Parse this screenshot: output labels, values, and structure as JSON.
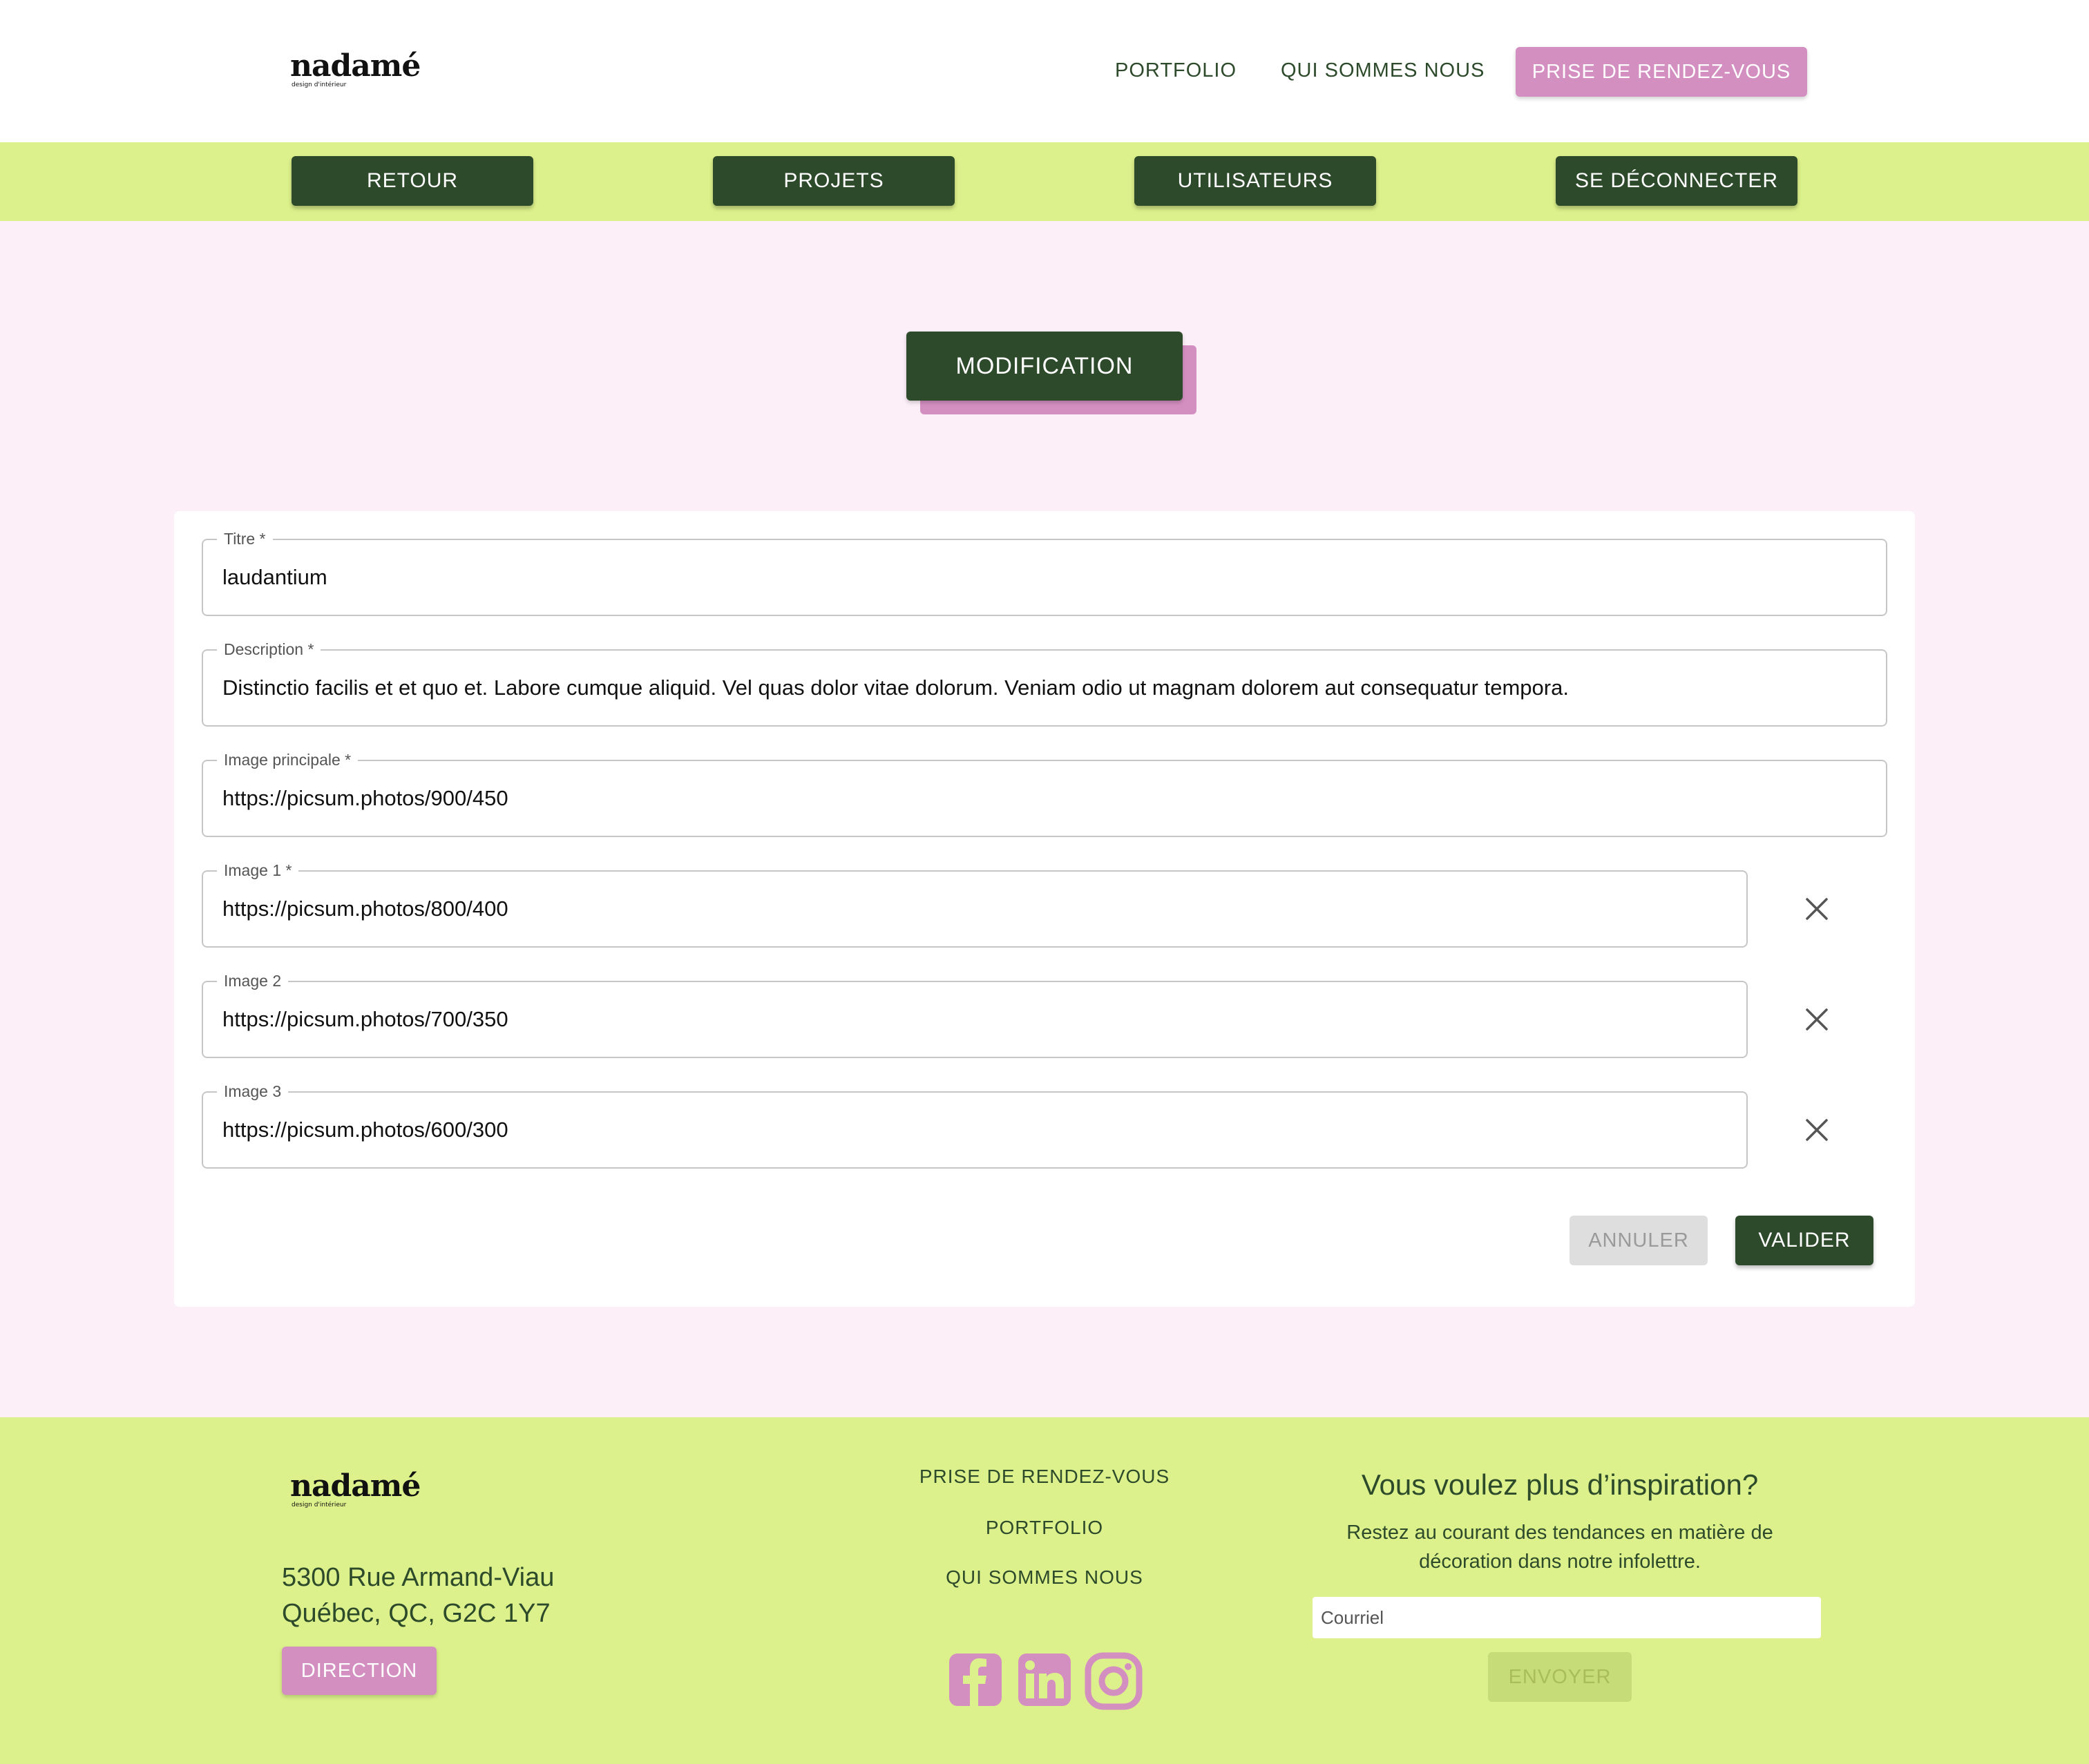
{
  "brand": {
    "name": "nadamé",
    "tagline": "design d'intérieur"
  },
  "header": {
    "nav": [
      "PORTFOLIO",
      "QUI SOMMES NOUS"
    ],
    "cta": "PRISE DE RENDEZ-VOUS"
  },
  "admin_nav": [
    "RETOUR",
    "PROJETS",
    "UTILISATEURS",
    "SE DÉCONNECTER"
  ],
  "page_title": "MODIFICATION",
  "form": {
    "fields": [
      {
        "label": "Titre",
        "required": "*",
        "value": "laudantium",
        "removable": false
      },
      {
        "label": "Description",
        "required": "*",
        "value": "Distinctio facilis et et quo et. Labore cumque aliquid. Vel quas dolor vitae dolorum. Veniam odio ut magnam dolorem aut consequatur tempora.",
        "removable": false
      },
      {
        "label": "Image principale",
        "required": "*",
        "value": "https://picsum.photos/900/450",
        "removable": false
      },
      {
        "label": "Image 1",
        "required": "*",
        "value": "https://picsum.photos/800/400",
        "removable": true
      },
      {
        "label": "Image 2",
        "required": "",
        "value": "https://picsum.photos/700/350",
        "removable": true
      },
      {
        "label": "Image 3",
        "required": "",
        "value": "https://picsum.photos/600/300",
        "removable": true
      }
    ],
    "remove_icon": "close-icon",
    "cancel": "ANNULER",
    "submit": "VALIDER"
  },
  "footer": {
    "address_line1": "5300 Rue Armand-Viau",
    "address_line2": "Québec, QC, G2C 1Y7",
    "direction": "DIRECTION",
    "links": [
      "PRISE DE RENDEZ-VOUS",
      "PORTFOLIO",
      "QUI SOMMES NOUS"
    ],
    "social_icons": [
      "facebook-icon",
      "linkedin-icon",
      "instagram-icon"
    ],
    "newsletter_title": "Vous voulez plus d’inspiration?",
    "newsletter_text": "Restez au courant des tendances en matière de décoration dans notre infolettre.",
    "email_placeholder": "Courriel",
    "send": "ENVOYER"
  },
  "colors": {
    "dark_green": "#2d4a2b",
    "pink": "#d48fc1",
    "lime": "#dcf18b",
    "page_bg": "#fdeff8"
  }
}
